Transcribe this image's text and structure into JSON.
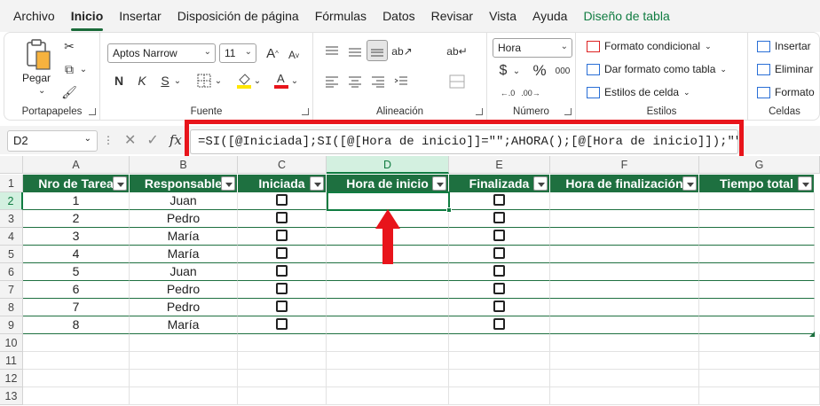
{
  "menu": {
    "items": [
      "Archivo",
      "Inicio",
      "Insertar",
      "Disposición de página",
      "Fórmulas",
      "Datos",
      "Revisar",
      "Vista",
      "Ayuda",
      "Diseño de tabla"
    ],
    "active": "Inicio"
  },
  "ribbon": {
    "clipboard": {
      "label": "Portapapeles",
      "paste_label": "Pegar"
    },
    "font": {
      "label": "Fuente",
      "font_name": "Aptos Narrow",
      "font_size": "11",
      "bold": "N",
      "italic": "K",
      "underline": "S",
      "grow": "A",
      "shrink": "A"
    },
    "alignment": {
      "label": "Alineación"
    },
    "number": {
      "label": "Número",
      "format": "Hora",
      "currency": "$",
      "percent": "%",
      "thousands": "000"
    },
    "styles": {
      "label": "Estilos",
      "conditional": "Formato condicional",
      "as_table": "Dar formato como tabla",
      "cell_styles": "Estilos de celda"
    },
    "cells": {
      "label": "Celdas",
      "insert": "Insertar",
      "delete": "Eliminar",
      "format": "Formato"
    }
  },
  "formula_bar": {
    "name_box": "D2",
    "formula": "=SI([@Iniciada];SI([@[Hora de inicio]]=\"\";AHORA();[@[Hora de inicio]]);\"\")"
  },
  "columns": [
    "A",
    "B",
    "C",
    "D",
    "E",
    "F",
    "G"
  ],
  "selected_column": "D",
  "selected_row": "2",
  "rows": [
    "1",
    "2",
    "3",
    "4",
    "5",
    "6",
    "7",
    "8",
    "9",
    "10",
    "11",
    "12",
    "13"
  ],
  "table": {
    "headers": [
      "Nro de Tarea",
      "Responsable",
      "Iniciada",
      "Hora de inicio",
      "Finalizada",
      "Hora de finalización",
      "Tiempo total"
    ],
    "rows": [
      {
        "nro": "1",
        "responsable": "Juan"
      },
      {
        "nro": "2",
        "responsable": "Pedro"
      },
      {
        "nro": "3",
        "responsable": "María"
      },
      {
        "nro": "4",
        "responsable": "María"
      },
      {
        "nro": "5",
        "responsable": "Juan"
      },
      {
        "nro": "6",
        "responsable": "Pedro"
      },
      {
        "nro": "7",
        "responsable": "Pedro"
      },
      {
        "nro": "8",
        "responsable": "María"
      }
    ]
  },
  "colors": {
    "table_header": "#1e7040",
    "highlight": "#e8141b",
    "accent": "#107c41"
  }
}
